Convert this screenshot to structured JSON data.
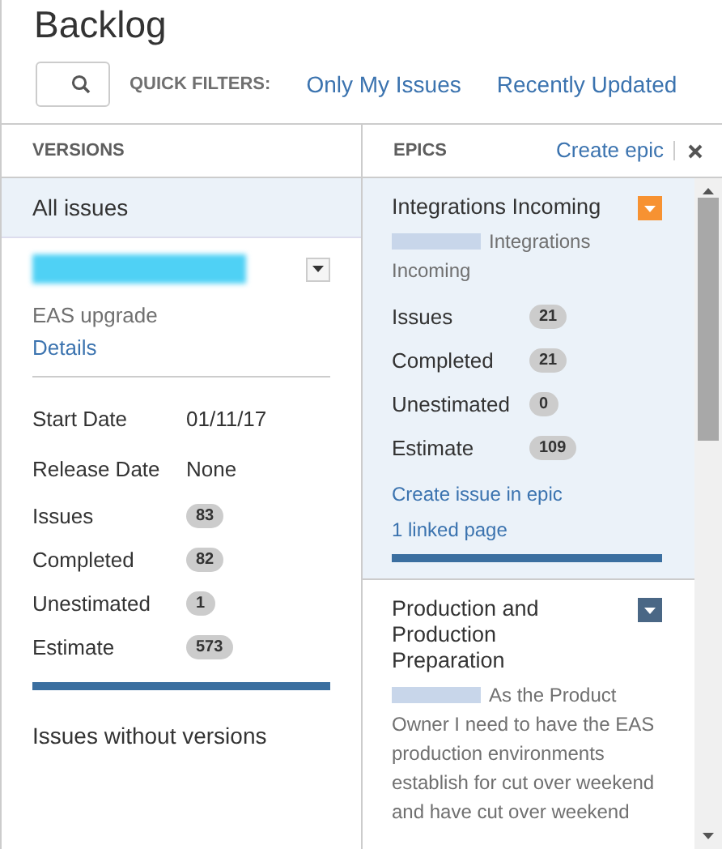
{
  "title": "Backlog",
  "quick_filters": {
    "label": "QUICK FILTERS:",
    "items": [
      "Only My Issues",
      "Recently Updated"
    ]
  },
  "versions": {
    "heading": "VERSIONS",
    "all_issues": {
      "label": "All issues",
      "selected": true
    },
    "items": [
      {
        "description": "EAS upgrade",
        "details_link": "Details",
        "dates": [
          {
            "label": "Start Date",
            "value": "01/11/17"
          },
          {
            "label": "Release Date",
            "value": "None"
          }
        ],
        "stats": [
          {
            "label": "Issues",
            "count": "83"
          },
          {
            "label": "Completed",
            "count": "82"
          },
          {
            "label": "Unestimated",
            "count": "1"
          },
          {
            "label": "Estimate",
            "count": "573"
          }
        ],
        "level": 1
      }
    ],
    "without_versions": {
      "label": "Issues without versions",
      "selected": false
    }
  },
  "epics": {
    "heading": "EPICS",
    "create_link": "Create epic",
    "items": [
      {
        "name": "Integrations Incoming",
        "summary": "Integrations Incoming",
        "selected": true,
        "color": "#f79232",
        "stats": [
          {
            "label": "Issues",
            "count": "21"
          },
          {
            "label": "Completed",
            "count": "21"
          },
          {
            "label": "Unestimated",
            "count": "0"
          },
          {
            "label": "Estimate",
            "count": "109"
          }
        ],
        "links": [
          "Create issue in epic",
          "1 linked page"
        ],
        "level": 1
      },
      {
        "name": "Production and Production Preparation",
        "summary": "As the Product Owner I need to have the EAS production environments establish for cut over weekend and have cut over weekend",
        "selected": false,
        "color": "#4a6785"
      }
    ]
  }
}
